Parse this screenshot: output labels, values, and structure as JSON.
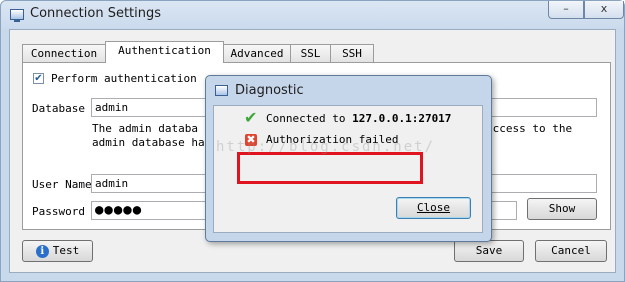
{
  "window": {
    "title": "Connection Settings",
    "minimize_label": "–",
    "close_label": "x"
  },
  "tabs": [
    {
      "label": "Connection"
    },
    {
      "label": "Authentication"
    },
    {
      "label": "Advanced"
    },
    {
      "label": "SSL"
    },
    {
      "label": "SSH"
    }
  ],
  "auth": {
    "perform_label": "Perform authentication",
    "perform_checked": true,
    "database_label": "Database",
    "database_value": "admin",
    "desc_line1": "The  admin  databa",
    "desc_line1_right": "access to the",
    "desc_line2": "admin database have",
    "username_label": "User Name",
    "username_value": "admin",
    "password_label": "Password",
    "password_value": "●●●●●",
    "show_label": "Show"
  },
  "footer": {
    "test_label": "Test",
    "save_label": "Save",
    "cancel_label": "Cancel"
  },
  "dialog": {
    "title": "Diagnostic",
    "connected_prefix": "Connected to ",
    "connected_host": "127.0.0.1:27017",
    "auth_failed": "Authorization failed",
    "close_label": "Close"
  },
  "watermark": "http://blog.csdn.net/",
  "colors": {
    "error_red": "#e0141e",
    "ok_green": "#3ea63a"
  }
}
